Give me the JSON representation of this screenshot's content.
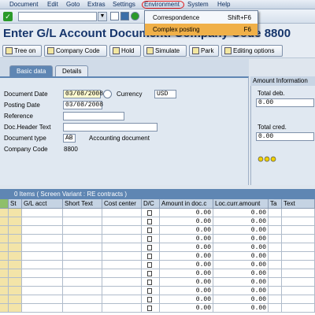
{
  "menu": {
    "items": [
      "Document",
      "Edit",
      "Goto",
      "Extras",
      "Settings",
      "Environment",
      "System",
      "Help"
    ],
    "dropdown": [
      {
        "label": "Correspondence",
        "shortcut": "Shift+F6"
      },
      {
        "label": "Complex posting",
        "shortcut": "F6"
      }
    ]
  },
  "title": "Enter G/L Account Document: Company Code 8800",
  "app_toolbar": {
    "tree_on": "Tree on",
    "company_code": "Company Code",
    "hold": "Hold",
    "simulate": "Simulate",
    "park": "Park",
    "editing_options": "Editing options"
  },
  "tabs": {
    "basic": "Basic data",
    "details": "Details"
  },
  "form": {
    "document_date_label": "Document Date",
    "document_date": "03/08/2008",
    "currency_label": "Currency",
    "currency": "USD",
    "posting_date_label": "Posting Date",
    "posting_date": "03/08/2008",
    "reference_label": "Reference",
    "reference": "",
    "doc_header_label": "Doc.Header Text",
    "doc_header": "",
    "doc_type_label": "Document type",
    "doc_type": "AB",
    "doc_type_desc": "Accounting document",
    "company_code_label": "Company Code",
    "company_code": "8800"
  },
  "amount_info": {
    "header": "Amount Information",
    "total_deb_label": "Total deb.",
    "total_deb": "0.00",
    "total_cred_label": "Total cred.",
    "total_cred": "0.00"
  },
  "table": {
    "title": "0 Items ( Screen Variant : RE contracts )",
    "columns": [
      "St",
      "G/L acct",
      "Short Text",
      "Cost center",
      "D/C",
      "Amount in doc.c",
      "Loc.curr.amount",
      "Ta",
      "Text"
    ],
    "row_value": "0.00",
    "row_count": 12
  }
}
